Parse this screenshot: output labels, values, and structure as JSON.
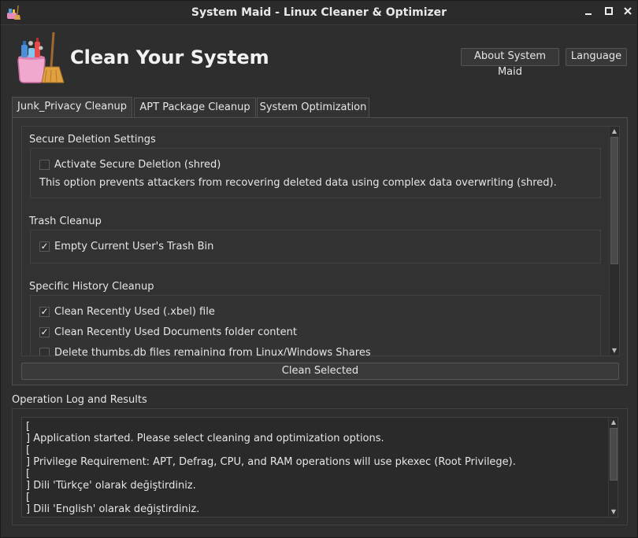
{
  "window": {
    "title": "System Maid - Linux Cleaner & Optimizer",
    "icon": "broom-bucket-icon"
  },
  "header": {
    "title": "Clean Your System",
    "about_label": "About System Maid",
    "language_label": "Language"
  },
  "tabs": [
    {
      "label": "Junk_Privacy Cleanup",
      "active": true
    },
    {
      "label": "APT Package Cleanup",
      "active": false
    },
    {
      "label": "System Optimization",
      "active": false
    }
  ],
  "sections": {
    "secure": {
      "title": "Secure Deletion Settings",
      "option": {
        "label": "Activate Secure Deletion (shred)",
        "checked": false
      },
      "help": "This option prevents attackers from recovering deleted data using complex data overwriting (shred)."
    },
    "trash": {
      "title": "Trash Cleanup",
      "option": {
        "label": "Empty Current User's Trash Bin",
        "checked": true
      }
    },
    "history": {
      "title": "Specific History Cleanup",
      "options": [
        {
          "label": "Clean Recently Used (.xbel) file",
          "checked": true
        },
        {
          "label": "Clean Recently Used Documents folder content",
          "checked": true
        },
        {
          "label": "Delete thumbs.db files remaining from Linux/Windows Shares",
          "checked": false
        }
      ]
    }
  },
  "clean_button_label": "Clean Selected",
  "log": {
    "title": "Operation Log and Results",
    "lines": [
      "[",
      "] Application started. Please select cleaning and optimization options.",
      "[",
      "] Privilege Requirement: APT, Defrag, CPU, and RAM operations will use pkexec (Root Privilege).",
      "[",
      "] Dili 'Türkçe' olarak değiştirdiniz.",
      "[",
      "] Dili 'English' olarak değiştirdiniz."
    ]
  },
  "glyphs": {
    "check": "✓",
    "arrow_up": "▲",
    "arrow_down": "▼",
    "minimize": "▁",
    "maximize": "☐",
    "close": "✕"
  }
}
